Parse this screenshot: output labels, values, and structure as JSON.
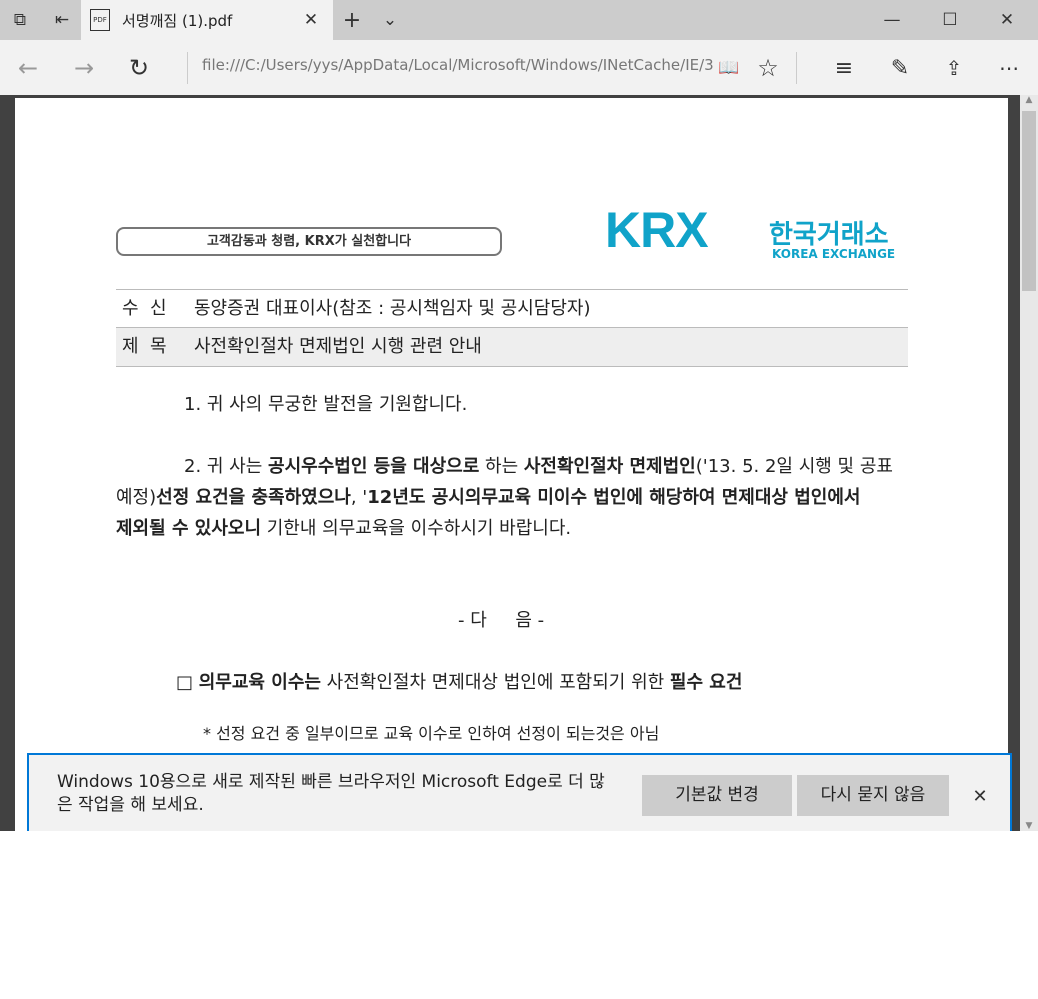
{
  "tab": {
    "title": "서명깨짐 (1).pdf",
    "icon_label": "PDF"
  },
  "address": {
    "url": "file:///C:/Users/yys/AppData/Local/Microsoft/Windows/INetCache/IE/3"
  },
  "doc": {
    "slogan": "고객감동과 청렴, KRX가 실천합니다",
    "logo_mark": "KRX",
    "logo_korean": "한국거래소",
    "logo_english": "KOREA EXCHANGE",
    "recipient_label": "수  신",
    "recipient": "동양증권 대표이사(참조 : 공시책임자 및 공시담당자)",
    "subject_label": "제  목",
    "subject": "사전확인절차 면제법인 시행 관련 안내",
    "para1": "1. 귀 사의 무궁한 발전을 기원합니다.",
    "para2": [
      {
        "t": "2. 귀 사는 ",
        "b": false
      },
      {
        "t": "공시우수법인 등을 대상으로",
        "b": true
      },
      {
        "t": " 하는 ",
        "b": false
      },
      {
        "t": "사전확인절차 면제법인",
        "b": true
      },
      {
        "t": "('13. 5. 2일 시행 및 공표 예정)",
        "b": false
      },
      {
        "t": "선정 요건을 충족하였으나",
        "b": true
      },
      {
        "t": ", '",
        "b": false
      },
      {
        "t": "12년도 공시의무교육 미이수 법인에 해당하여 면제대상 법인에서 제외될 수 있사오니",
        "b": true
      },
      {
        "t": " 기한내 의무교육을 이수하시기 바랍니다.",
        "b": false
      }
    ],
    "next": "- 다     음 -",
    "item_box": "□",
    "item": [
      {
        "t": "의무교육 이수는",
        "b": true
      },
      {
        "t": " 사전확인절차 면제대상 법인에 포함되기 위한 ",
        "b": false
      },
      {
        "t": "필수 요건",
        "b": true
      }
    ],
    "note": "*  선정 요건 중 일부이므로 교육 이수로 인하여 선정이 되는것은 아님"
  },
  "notification": {
    "message": "Windows 10용으로 새로 제작된 빠른 브라우저인 Microsoft Edge로 더 많은 작업을 해 보세요.",
    "default_button": "기본값 변경",
    "dismiss_button": "다시 묻지 않음"
  }
}
